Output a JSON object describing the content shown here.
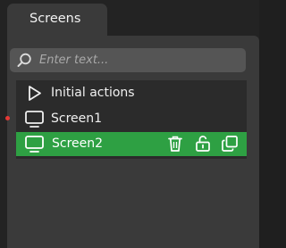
{
  "tab": {
    "title": "Screens"
  },
  "search": {
    "placeholder": "Enter text...",
    "value": ""
  },
  "items": [
    {
      "label": "Initial actions",
      "icon": "play-icon"
    },
    {
      "label": "Screen1",
      "icon": "monitor-icon",
      "modified": true
    },
    {
      "label": "Screen2",
      "icon": "monitor-icon",
      "selected": true
    }
  ],
  "item_actions": [
    {
      "icon": "trash-icon"
    },
    {
      "icon": "unlock-icon"
    },
    {
      "icon": "duplicate-icon"
    }
  ],
  "colors": {
    "panel": "#3a3a3a",
    "list": "#2b2b2b",
    "selected": "#2ea043",
    "modified_dot": "#e53935"
  }
}
